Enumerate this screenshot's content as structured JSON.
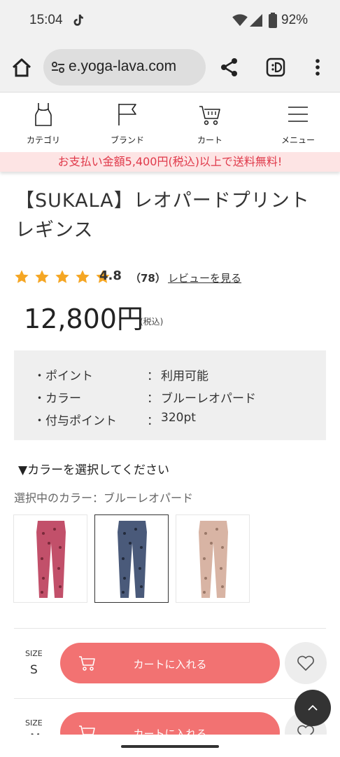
{
  "status_bar": {
    "time": "15:04",
    "battery": "92%"
  },
  "browser": {
    "url": "e.yoga-lava.com"
  },
  "site_nav": [
    {
      "label": "カテゴリ",
      "icon": "tank-top-icon"
    },
    {
      "label": "ブランド",
      "icon": "flag-icon"
    },
    {
      "label": "カート",
      "icon": "cart-icon"
    },
    {
      "label": "メニュー",
      "icon": "hamburger-icon"
    }
  ],
  "promo": {
    "text": "お支払い金額5,400円(税込)以上で送料無料!"
  },
  "product": {
    "title_line1": "【SUKALA】レオパードプリント",
    "title_line2": "レギンス",
    "rating": {
      "value": "4.8",
      "count": "（78）",
      "stars": 5,
      "review_link": "レビューを見る"
    },
    "price": "12,800円",
    "tax_note": "(税込)",
    "info": [
      {
        "key": "・ポイント",
        "colon": "：",
        "value": "利用可能"
      },
      {
        "key": "・カラー",
        "colon": "：",
        "value": "ブルーレオパード"
      },
      {
        "key": "・付与ポイント",
        "colon": "：",
        "value": "320pt"
      }
    ]
  },
  "color_select": {
    "heading": "▼カラーを選択してください",
    "current": "選択中のカラー：ブルーレオパード",
    "swatches": [
      {
        "color": "#c2506a",
        "spot": "#7a2a3a"
      },
      {
        "color": "#4a5a7a",
        "spot": "#232b3c"
      },
      {
        "color": "#d8b4a4",
        "spot": "#9a7868"
      }
    ],
    "selected_index": 1
  },
  "sizes": [
    {
      "size_label": "SIZE",
      "size": "S",
      "cart_label": "カートに入れる"
    },
    {
      "size_label": "SIZE",
      "size": "M",
      "cart_label": "カートに入れる"
    }
  ],
  "colors": {
    "accent": "#f27272",
    "promo_text": "#e0394a",
    "promo_bg": "#fde4e4",
    "star": "#f5a623"
  }
}
